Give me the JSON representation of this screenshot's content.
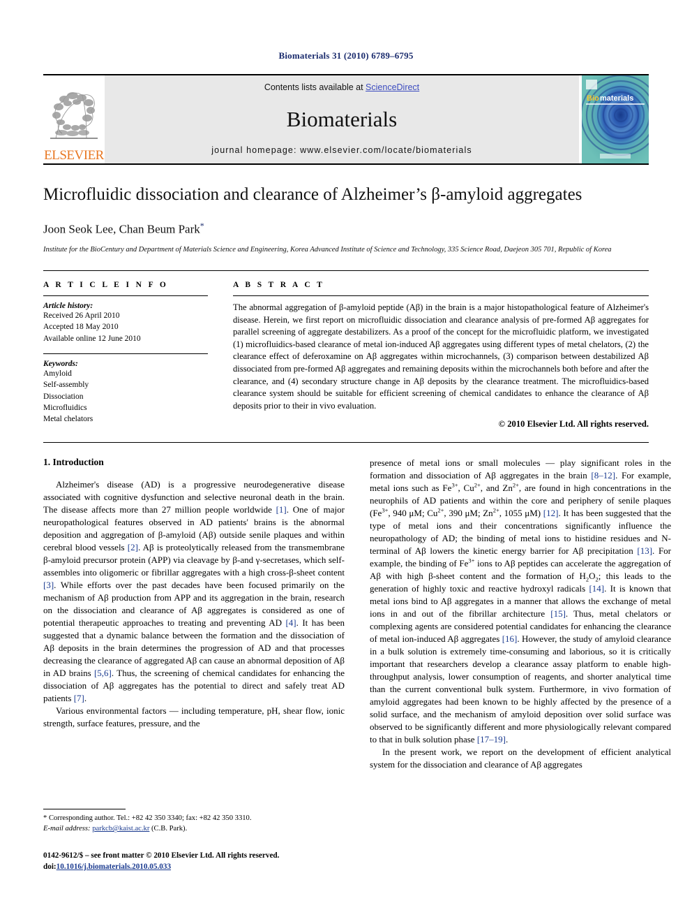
{
  "running_head": "Biomaterials 31 (2010) 6789–6795",
  "masthead": {
    "publisher_name": "ELSEVIER",
    "contents_prefix": "Contents lists available at ",
    "contents_link": "ScienceDirect",
    "journal_title": "Biomaterials",
    "homepage": "journal homepage: www.elsevier.com/locate/biomaterials",
    "cover_label_bio": "Bio",
    "cover_label_materials": "materials"
  },
  "article": {
    "title": "Microfluidic dissociation and clearance of Alzheimer’s β-amyloid aggregates",
    "authors": "Joon Seok Lee, Chan Beum Park",
    "corresponding_marker": "*",
    "affiliation": "Institute for the BioCentury and Department of Materials Science and Engineering, Korea Advanced Institute of Science and Technology, 335 Science Road, Daejeon 305 701, Republic of Korea"
  },
  "article_info": {
    "heading": "A R T I C L E   I N F O",
    "history_label": "Article history:",
    "history": [
      "Received 26 April 2010",
      "Accepted 18 May 2010",
      "Available online 12 June 2010"
    ],
    "keywords_label": "Keywords:",
    "keywords": [
      "Amyloid",
      "Self-assembly",
      "Dissociation",
      "Microfluidics",
      "Metal chelators"
    ]
  },
  "abstract": {
    "heading": "A B S T R A C T",
    "text": "The abnormal aggregation of β-amyloid peptide (Aβ) in the brain is a major histopathological feature of Alzheimer's disease. Herein, we first report on microfluidic dissociation and clearance analysis of pre-formed Aβ aggregates for parallel screening of aggregate destabilizers. As a proof of the concept for the microfluidic platform, we investigated (1) microfluidics-based clearance of metal ion-induced Aβ aggregates using different types of metal chelators, (2) the clearance effect of deferoxamine on Aβ aggregates within microchannels, (3) comparison between destabilized Aβ dissociated from pre-formed Aβ aggregates and remaining deposits within the microchannels both before and after the clearance, and (4) secondary structure change in Aβ deposits by the clearance treatment. The microfluidics-based clearance system should be suitable for efficient screening of chemical candidates to enhance the clearance of Aβ deposits prior to their in vivo evaluation.",
    "copyright": "© 2010 Elsevier Ltd. All rights reserved."
  },
  "body": {
    "section_number_title": "1. Introduction",
    "left_paragraph_1_part1": "Alzheimer's disease (AD) is a progressive neurodegenerative disease associated with cognitive dysfunction and selective neuronal death in the brain. The disease affects more than 27 million people worldwide ",
    "ref1": "[1]",
    "left_paragraph_1_part2": ". One of major neuropathological features observed in AD patients' brains is the abnormal deposition and aggregation of β-amyloid (Aβ) outside senile plaques and within cerebral blood vessels ",
    "ref2": "[2]",
    "left_paragraph_1_part3": ". Aβ is proteolytically released from the transmembrane β-amyloid precursor protein (APP) via cleavage by β-and γ-secretases, which self-assembles into oligomeric or fibrillar aggregates with a high cross-β-sheet content ",
    "ref3": "[3]",
    "left_paragraph_1_part4": ". While efforts over the past decades have been focused primarily on the mechanism of Aβ production from APP and its aggregation in the brain, research on the dissociation and clearance of Aβ aggregates is considered as one of potential therapeutic approaches to treating and preventing AD ",
    "ref4": "[4]",
    "left_paragraph_1_part5": ". It has been suggested that a dynamic balance between the formation and the dissociation of Aβ deposits in the brain determines the progression of AD and that processes decreasing the clearance of aggregated Aβ can cause an abnormal deposition of Aβ in AD brains ",
    "ref56": "[5,6]",
    "left_paragraph_1_part6": ". Thus, the screening of chemical candidates for enhancing the dissociation of Aβ aggregates has the potential to direct and safely treat AD patients ",
    "ref7": "[7]",
    "left_paragraph_1_part7": ".",
    "left_paragraph_2": "Various environmental factors — including temperature, pH, shear flow, ionic strength, surface features, pressure, and the",
    "right_paragraph_1_part1": "presence of metal ions or small molecules — play significant roles in the formation and dissociation of Aβ aggregates in the brain ",
    "ref8_12": "[8–12]",
    "right_paragraph_1_part2": ". For example, metal ions such as Fe",
    "sup_3plus_a": "3+",
    "right_paragraph_1_part3": ", Cu",
    "sup_2plus_a": "2+",
    "right_paragraph_1_part4": ", and Zn",
    "sup_2plus_b": "2+",
    "right_paragraph_1_part5": ", are found in high concentrations in the neurophils of AD patients and within the core and periphery of senile plaques (Fe",
    "sup_3plus_b": "3+",
    "right_paragraph_1_part6": ", 940 μM; Cu",
    "sup_2plus_c": "2+",
    "right_paragraph_1_part7": ", 390 μM; Zn",
    "sup_2plus_d": "2+",
    "right_paragraph_1_part8": ", 1055 μM) ",
    "ref12": "[12]",
    "right_paragraph_1_part9": ". It has been suggested that the type of metal ions and their concentrations significantly influence the neuropathology of AD; the binding of metal ions to histidine residues and N-terminal of Aβ lowers the kinetic energy barrier for Aβ precipitation ",
    "ref13": "[13]",
    "right_paragraph_1_part10": ". For example, the binding of Fe",
    "sup_3plus_c": "3+",
    "right_paragraph_1_part11": " ions to Aβ peptides can accelerate the aggregation of Aβ with high β-sheet content and the formation of H",
    "sub_2_a": "2",
    "right_paragraph_1_part12": "O",
    "sub_2_b": "2",
    "right_paragraph_1_part13": "; this leads to the generation of highly toxic and reactive hydroxyl radicals ",
    "ref14": "[14]",
    "right_paragraph_1_part14": ". It is known that metal ions bind to Aβ aggregates in a manner that allows the exchange of metal ions in and out of the fibrillar architecture ",
    "ref15": "[15]",
    "right_paragraph_1_part15": ". Thus, metal chelators or complexing agents are considered potential candidates for enhancing the clearance of metal ion-induced Aβ aggregates ",
    "ref16": "[16]",
    "right_paragraph_1_part16": ". However, the study of amyloid clearance in a bulk solution is extremely time-consuming and laborious, so it is critically important that researchers develop a clearance assay platform to enable high-throughput analysis, lower consumption of reagents, and shorter analytical time than the current conventional bulk system. Furthermore, in vivo formation of amyloid aggregates had been known to be highly affected by the presence of a solid surface, and the mechanism of amyloid deposition over solid surface was observed to be significantly different and more physiologically relevant compared to that in bulk solution phase ",
    "ref17_19": "[17–19]",
    "right_paragraph_1_part17": ".",
    "right_paragraph_2": "In the present work, we report on the development of efficient analytical system for the dissociation and clearance of Aβ aggregates"
  },
  "footnotes": {
    "corresponding": "* Corresponding author. Tel.: +82 42 350 3340; fax: +82 42 350 3310.",
    "email_label": "E-mail address:",
    "email": "parkcb@kaist.ac.kr",
    "email_suffix": "(C.B. Park)."
  },
  "footer": {
    "issn_line": "0142-9612/$ – see front matter © 2010 Elsevier Ltd. All rights reserved.",
    "doi_label": "doi:",
    "doi": "10.1016/j.biomaterials.2010.05.033"
  }
}
